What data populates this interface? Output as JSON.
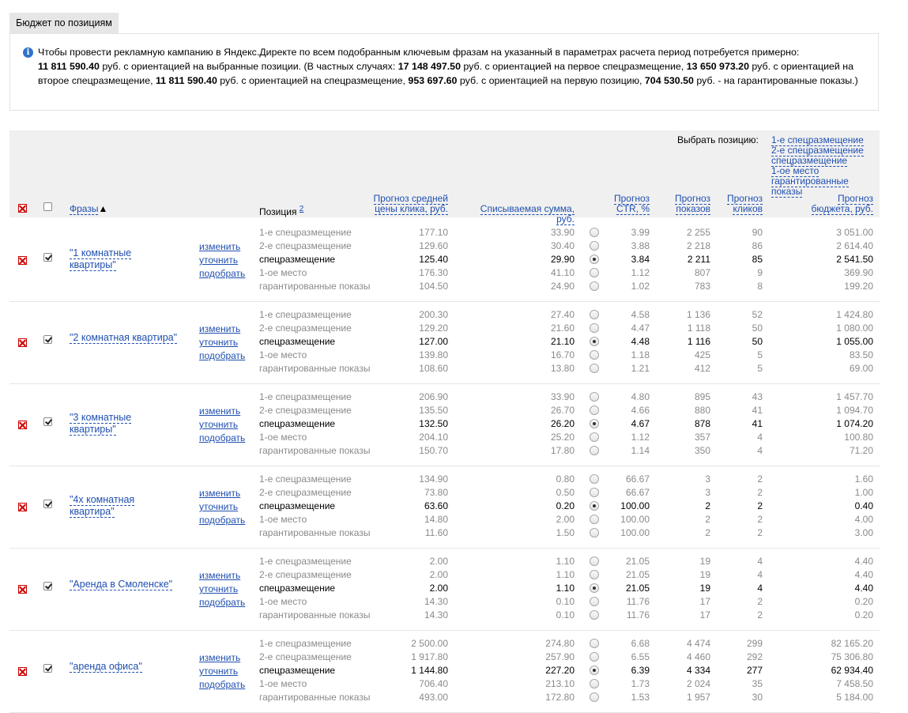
{
  "tab_title": "Бюджет по позициям",
  "info": {
    "text_intro": "Чтобы провести рекламную кампанию в Яндекс.Директе по всем подобранным ключевым фразам на указанный в параметрах расчета период потребуется примерно:",
    "total": "11 811 590.40",
    "t1": " руб. с ориентацией на выбранные позиции. (В частных случаях: ",
    "v1": "17 148 497.50",
    "t2": " руб. с ориентацией на первое спецразмещение, ",
    "v2": "13 650 973.20",
    "t3": " руб. с ориентацией на второе спецразмещение, ",
    "v3": "11 811 590.40",
    "t4": " руб. с ориентацией на спецразмещение, ",
    "v4": "953 697.60",
    "t5": " руб. с ориентацией на первую позицию, ",
    "v5": "704 530.50",
    "t6": " руб. - на гарантированные показы.)"
  },
  "header": {
    "select_label": "Выбрать позицию:",
    "select_links": [
      "1-е спецразмещение",
      "2-е спецразмещение",
      "спецразмещение",
      "1-ое место",
      "гарантированные показы"
    ],
    "col_phrases": "Фразы",
    "sort_arrow": "▲",
    "col_position": "Позиция",
    "col_position_sup": "2",
    "col_cpc_1": "Прогноз средней",
    "col_cpc_2": "цены клика, руб.",
    "col_charge": "Списываемая сумма, руб.",
    "col_ctr_1": "Прогноз",
    "col_ctr_2": "CTR, %",
    "col_shows_1": "Прогноз",
    "col_shows_2": "показов",
    "col_clicks_1": "Прогноз",
    "col_clicks_2": "кликов",
    "col_budget_1": "Прогноз",
    "col_budget_2": "бюджета, руб."
  },
  "actions": [
    "изменить",
    "уточнить",
    "подобрать"
  ],
  "groups": [
    {
      "phrase_lines": [
        "\"1 комнатные",
        "квартиры\""
      ],
      "selected": 2,
      "rows": [
        {
          "pos": "1-е спецразмещение",
          "cpc": "177.10",
          "charge": "33.90",
          "ctr": "3.99",
          "shows": "2 255",
          "clicks": "90",
          "budget": "3 051.00"
        },
        {
          "pos": "2-е спецразмещение",
          "cpc": "129.60",
          "charge": "30.40",
          "ctr": "3.88",
          "shows": "2 218",
          "clicks": "86",
          "budget": "2 614.40"
        },
        {
          "pos": "спецразмещение",
          "cpc": "125.40",
          "charge": "29.90",
          "ctr": "3.84",
          "shows": "2 211",
          "clicks": "85",
          "budget": "2 541.50"
        },
        {
          "pos": "1-ое место",
          "cpc": "176.30",
          "charge": "41.10",
          "ctr": "1.12",
          "shows": "807",
          "clicks": "9",
          "budget": "369.90"
        },
        {
          "pos": "гарантированные показы",
          "cpc": "104.50",
          "charge": "24.90",
          "ctr": "1.02",
          "shows": "783",
          "clicks": "8",
          "budget": "199.20"
        }
      ]
    },
    {
      "phrase_lines": [
        "\"2 комнатная квартира\""
      ],
      "selected": 2,
      "rows": [
        {
          "pos": "1-е спецразмещение",
          "cpc": "200.30",
          "charge": "27.40",
          "ctr": "4.58",
          "shows": "1 136",
          "clicks": "52",
          "budget": "1 424.80"
        },
        {
          "pos": "2-е спецразмещение",
          "cpc": "129.20",
          "charge": "21.60",
          "ctr": "4.47",
          "shows": "1 118",
          "clicks": "50",
          "budget": "1 080.00"
        },
        {
          "pos": "спецразмещение",
          "cpc": "127.00",
          "charge": "21.10",
          "ctr": "4.48",
          "shows": "1 116",
          "clicks": "50",
          "budget": "1 055.00"
        },
        {
          "pos": "1-ое место",
          "cpc": "139.80",
          "charge": "16.70",
          "ctr": "1.18",
          "shows": "425",
          "clicks": "5",
          "budget": "83.50"
        },
        {
          "pos": "гарантированные показы",
          "cpc": "108.60",
          "charge": "13.80",
          "ctr": "1.21",
          "shows": "412",
          "clicks": "5",
          "budget": "69.00"
        }
      ]
    },
    {
      "phrase_lines": [
        "\"3 комнатные",
        "квартиры\""
      ],
      "selected": 2,
      "rows": [
        {
          "pos": "1-е спецразмещение",
          "cpc": "206.90",
          "charge": "33.90",
          "ctr": "4.80",
          "shows": "895",
          "clicks": "43",
          "budget": "1 457.70"
        },
        {
          "pos": "2-е спецразмещение",
          "cpc": "135.50",
          "charge": "26.70",
          "ctr": "4.66",
          "shows": "880",
          "clicks": "41",
          "budget": "1 094.70"
        },
        {
          "pos": "спецразмещение",
          "cpc": "132.50",
          "charge": "26.20",
          "ctr": "4.67",
          "shows": "878",
          "clicks": "41",
          "budget": "1 074.20"
        },
        {
          "pos": "1-ое место",
          "cpc": "204.10",
          "charge": "25.20",
          "ctr": "1.12",
          "shows": "357",
          "clicks": "4",
          "budget": "100.80"
        },
        {
          "pos": "гарантированные показы",
          "cpc": "150.70",
          "charge": "17.80",
          "ctr": "1.14",
          "shows": "350",
          "clicks": "4",
          "budget": "71.20"
        }
      ]
    },
    {
      "phrase_lines": [
        "\"4х комнатная",
        "квартира\""
      ],
      "selected": 2,
      "rows": [
        {
          "pos": "1-е спецразмещение",
          "cpc": "134.90",
          "charge": "0.80",
          "ctr": "66.67",
          "shows": "3",
          "clicks": "2",
          "budget": "1.60"
        },
        {
          "pos": "2-е спецразмещение",
          "cpc": "73.80",
          "charge": "0.50",
          "ctr": "66.67",
          "shows": "3",
          "clicks": "2",
          "budget": "1.00"
        },
        {
          "pos": "спецразмещение",
          "cpc": "63.60",
          "charge": "0.20",
          "ctr": "100.00",
          "shows": "2",
          "clicks": "2",
          "budget": "0.40"
        },
        {
          "pos": "1-ое место",
          "cpc": "14.80",
          "charge": "2.00",
          "ctr": "100.00",
          "shows": "2",
          "clicks": "2",
          "budget": "4.00"
        },
        {
          "pos": "гарантированные показы",
          "cpc": "11.60",
          "charge": "1.50",
          "ctr": "100.00",
          "shows": "2",
          "clicks": "2",
          "budget": "3.00"
        }
      ]
    },
    {
      "phrase_lines": [
        "\"Аренда в Смоленске\""
      ],
      "selected": 2,
      "rows": [
        {
          "pos": "1-е спецразмещение",
          "cpc": "2.00",
          "charge": "1.10",
          "ctr": "21.05",
          "shows": "19",
          "clicks": "4",
          "budget": "4.40"
        },
        {
          "pos": "2-е спецразмещение",
          "cpc": "2.00",
          "charge": "1.10",
          "ctr": "21.05",
          "shows": "19",
          "clicks": "4",
          "budget": "4.40"
        },
        {
          "pos": "спецразмещение",
          "cpc": "2.00",
          "charge": "1.10",
          "ctr": "21.05",
          "shows": "19",
          "clicks": "4",
          "budget": "4.40"
        },
        {
          "pos": "1-ое место",
          "cpc": "14.30",
          "charge": "0.10",
          "ctr": "11.76",
          "shows": "17",
          "clicks": "2",
          "budget": "0.20"
        },
        {
          "pos": "гарантированные показы",
          "cpc": "14.30",
          "charge": "0.10",
          "ctr": "11.76",
          "shows": "17",
          "clicks": "2",
          "budget": "0.20"
        }
      ]
    },
    {
      "phrase_lines": [
        "\"аренда офиса\""
      ],
      "selected": 2,
      "rows": [
        {
          "pos": "1-е спецразмещение",
          "cpc": "2 500.00",
          "charge": "274.80",
          "ctr": "6.68",
          "shows": "4 474",
          "clicks": "299",
          "budget": "82 165.20"
        },
        {
          "pos": "2-е спецразмещение",
          "cpc": "1 917.80",
          "charge": "257.90",
          "ctr": "6.55",
          "shows": "4 460",
          "clicks": "292",
          "budget": "75 306.80"
        },
        {
          "pos": "спецразмещение",
          "cpc": "1 144.80",
          "charge": "227.20",
          "ctr": "6.39",
          "shows": "4 334",
          "clicks": "277",
          "budget": "62 934.40"
        },
        {
          "pos": "1-ое место",
          "cpc": "706.40",
          "charge": "213.10",
          "ctr": "1.73",
          "shows": "2 024",
          "clicks": "35",
          "budget": "7 458.50"
        },
        {
          "pos": "гарантированные показы",
          "cpc": "493.00",
          "charge": "172.80",
          "ctr": "1.53",
          "shows": "1 957",
          "clicks": "30",
          "budget": "5 184.00"
        }
      ]
    }
  ]
}
